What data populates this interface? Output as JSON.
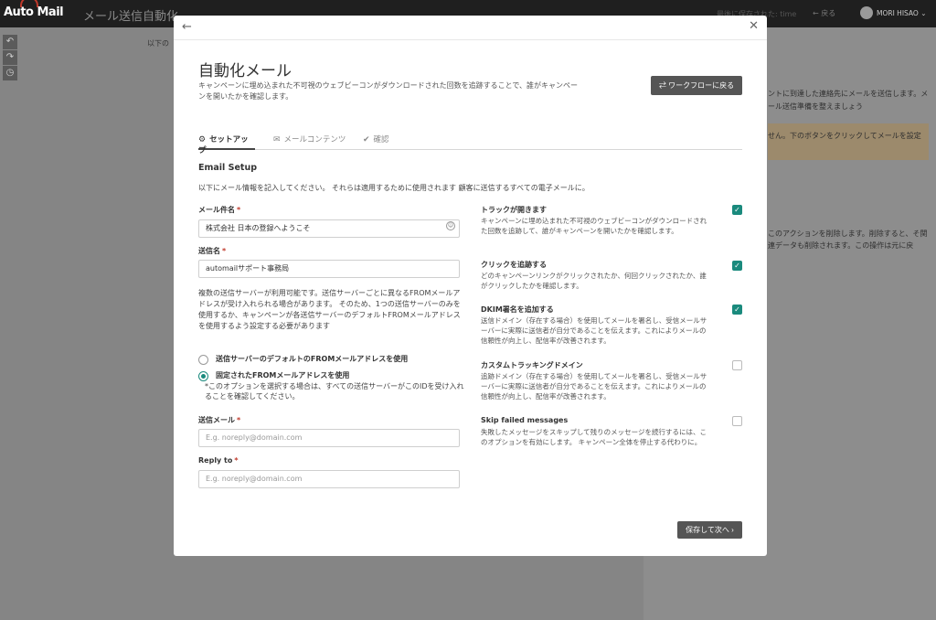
{
  "app": {
    "logo": "Auto Mail",
    "title": "メール送信自動化",
    "last_saved": "最後に保存された: time",
    "back_label": "← 戻る",
    "user_name": "MORI HISAO ⌄"
  },
  "background": {
    "left_text": "以下の",
    "right_text_1": "ントに到達した連絡先にメールを送信します。メール送信準備を整えましょう",
    "warning_text": "せん。下のボタンをクリックしてメールを設定",
    "right_text_2": "このアクションを削除します。削除すると、そ関連データも削除されます。この操作は元に戻"
  },
  "modal": {
    "title": "自動化メール",
    "description": "キャンペーンに埋め込まれた不可視のウェブビーコンがダウンロードされた回数を追跡することで、誰がキャンペーンを開いたかを確認します。",
    "workflow_button": "ワークフローに戻る",
    "tabs": [
      {
        "label": "セットアップ",
        "icon": "gear-icon"
      },
      {
        "label": "メールコンテンツ",
        "icon": "mail-icon"
      },
      {
        "label": "確認",
        "icon": "check-icon"
      }
    ],
    "section_title": "Email Setup",
    "section_desc": "以下にメール情報を記入してください。 それらは適用するために使用されます 顧客に送信するすべての電子メールに。",
    "subject_label": "メール件名",
    "subject_value": "株式会社 日本の登録へようこそ",
    "sender_label": "送信名",
    "sender_value": "automailサポート事務局",
    "multi_server_text": "複数の送信サーバーが利用可能です。送信サーバーごとに異なるFROMメールアドレスが受け入れられる場合があります。 そのため、1つの送信サーバーのみを使用するか、キャンペーンが各送信サーバーのデフォルトFROMメールアドレスを使用するよう設定する必要があります",
    "radio_default": "送信サーバーのデフォルトのFROMメールアドレスを使用",
    "radio_fixed": "固定されたFROMメールアドレスを使用",
    "radio_fixed_note": "*このオプションを選択する場合は、すべての送信サーバーがこのIDを受け入れることを確認してください。",
    "from_label": "送信メール",
    "from_placeholder": "E.g. noreply@domain.com",
    "reply_label": "Reply to",
    "reply_placeholder": "E.g. noreply@domain.com",
    "options": [
      {
        "title": "トラックが開きます",
        "desc": "キャンペーンに埋め込まれた不可視のウェブビーコンがダウンロードされた回数を追跡して、誰がキャンペーンを開いたかを確認します。",
        "checked": true
      },
      {
        "title": "クリックを追跡する",
        "desc": "どのキャンペーンリンクがクリックされたか、何回クリックされたか、誰がクリックしたかを確認します。",
        "checked": true
      },
      {
        "title": "DKIM署名を追加する",
        "desc": "送信ドメイン（存在する場合）を使用してメールを署名し、受信メールサーバーに実際に送信者が自分であることを伝えます。これによりメールの信頼性が向上し、配信率が改善されます。",
        "checked": true
      },
      {
        "title": "カスタムトラッキングドメイン",
        "desc": "追跡ドメイン（存在する場合）を使用してメールを署名し、受信メールサーバーに実際に送信者が自分であることを伝えます。これによりメールの信頼性が向上し、配信率が改善されます。",
        "checked": false
      },
      {
        "title": "Skip failed messages",
        "desc": "失敗したメッセージをスキップして残りのメッセージを続行するには、このオプションを有効にします。 キャンペーン全体を停止する代わりに。",
        "checked": false
      }
    ],
    "save_button": "保存して次へ ›"
  }
}
